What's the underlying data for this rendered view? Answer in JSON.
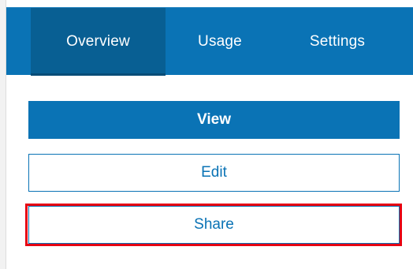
{
  "tabs": [
    {
      "label": "Overview",
      "active": true
    },
    {
      "label": "Usage",
      "active": false
    },
    {
      "label": "Settings",
      "active": false
    }
  ],
  "buttons": {
    "view_label": "View",
    "edit_label": "Edit",
    "share_label": "Share"
  },
  "colors": {
    "brand_blue": "#0a73b5",
    "active_tab": "#085f93",
    "highlight_red": "#e60012"
  }
}
